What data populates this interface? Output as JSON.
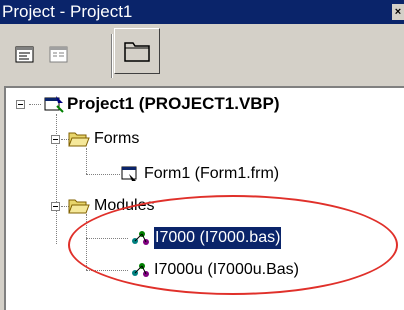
{
  "window": {
    "title": "Project - Project1",
    "close_label": "×"
  },
  "toolbar": {
    "buttons": [
      {
        "name": "view-code",
        "icon": "code-view-icon"
      },
      {
        "name": "view-object",
        "icon": "form-view-icon"
      },
      {
        "name": "toggle-folders",
        "icon": "folder-icon"
      }
    ]
  },
  "tree": {
    "project": {
      "label": "Project1 (PROJECT1.VBP)",
      "icon": "vb-project-icon",
      "expanded": true
    },
    "forms_folder": {
      "label": "Forms",
      "icon": "folder-open-icon",
      "expanded": true
    },
    "form1": {
      "label": "Form1 (Form1.frm)",
      "icon": "form-icon"
    },
    "modules_folder": {
      "label": "Modules",
      "icon": "folder-open-icon",
      "expanded": true
    },
    "modules": [
      {
        "label": "I7000 (I7000.bas)",
        "icon": "module-icon",
        "selected": true
      },
      {
        "label": "I7000u (I7000u.Bas)",
        "icon": "module-icon",
        "selected": false
      }
    ]
  },
  "annotation": {
    "highlight_color": "#e0302a"
  },
  "colors": {
    "title_bar": "#0a246a",
    "selection": "#0a246a",
    "window_face": "#d4d0c8"
  }
}
